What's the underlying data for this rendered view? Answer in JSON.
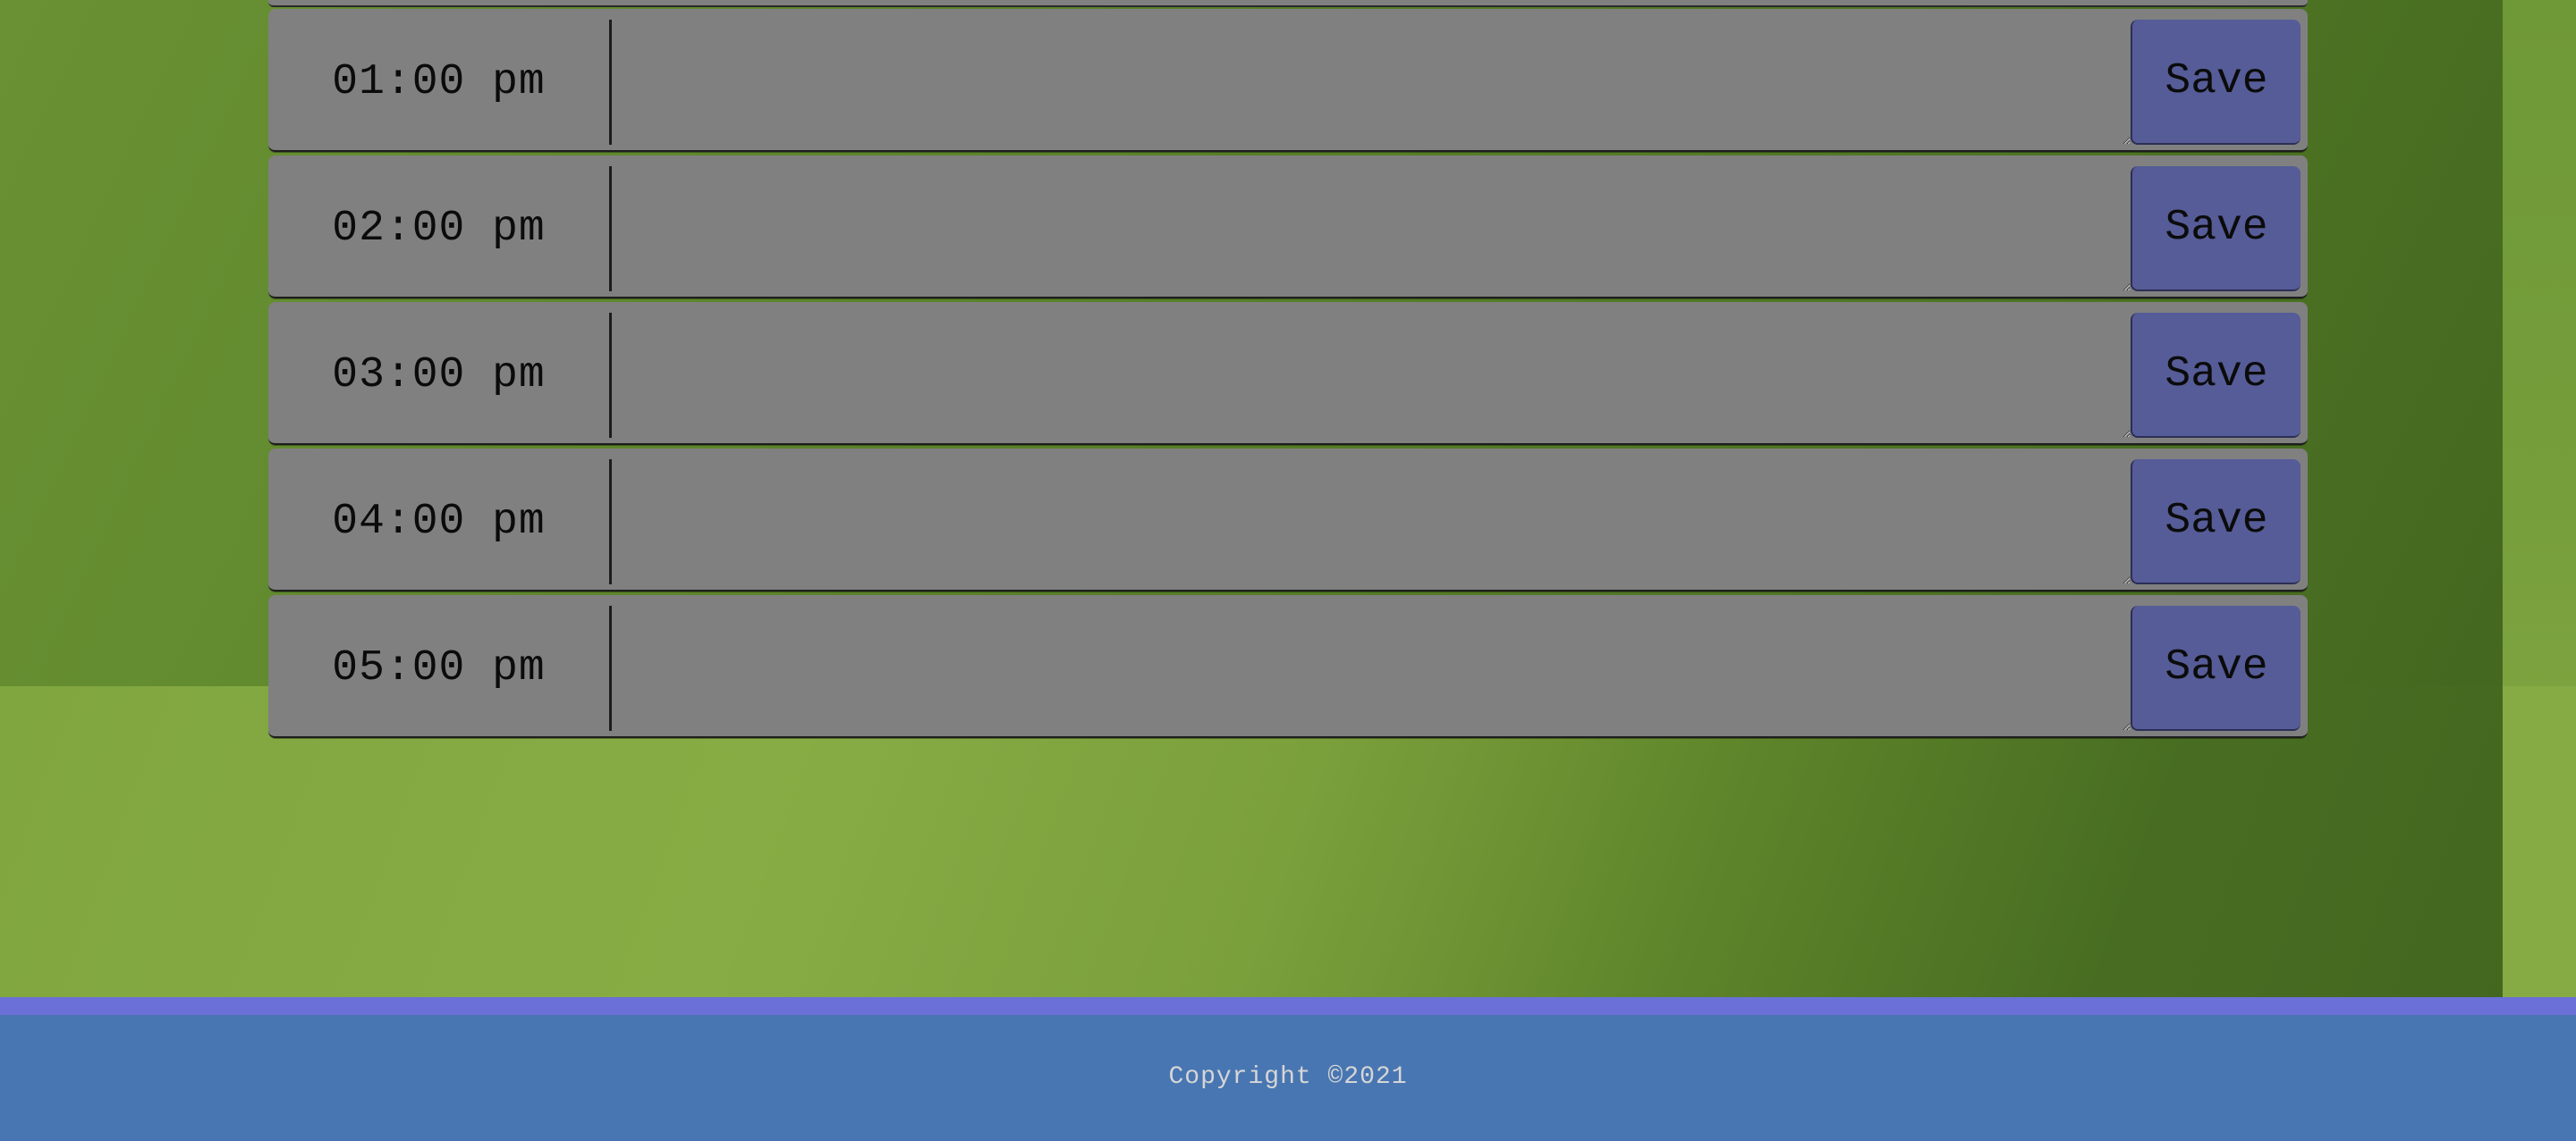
{
  "schedule": {
    "rows": [
      {
        "hour": "01:00 pm",
        "description": "",
        "save_label": "Save"
      },
      {
        "hour": "02:00 pm",
        "description": "",
        "save_label": "Save"
      },
      {
        "hour": "03:00 pm",
        "description": "",
        "save_label": "Save"
      },
      {
        "hour": "04:00 pm",
        "description": "",
        "save_label": "Save"
      },
      {
        "hour": "05:00 pm",
        "description": "",
        "save_label": "Save"
      }
    ]
  },
  "footer": {
    "copyright": "Copyright ©2021"
  },
  "colors": {
    "row_background": "#808080",
    "save_button": "#555c97",
    "footer_background": "#4876b2",
    "footer_border": "#6b6fd8",
    "background_green": "#6a9234"
  }
}
